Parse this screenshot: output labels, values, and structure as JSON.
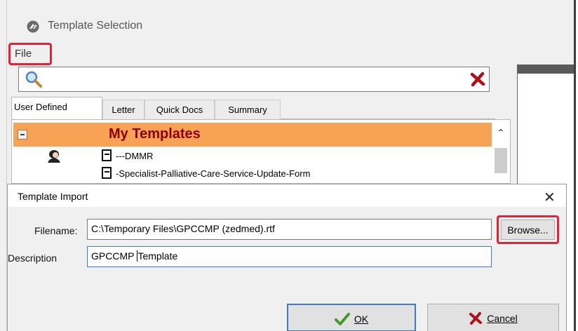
{
  "window": {
    "title": "Template Selection",
    "icon": "app-logo-icon"
  },
  "menu": {
    "file_label": "File"
  },
  "search": {
    "placeholder": "",
    "search_icon": "magnifier-icon",
    "clear_icon": "red-x-icon"
  },
  "tabs": [
    {
      "label": "User Defined",
      "active": true
    },
    {
      "label": "Letter",
      "active": false
    },
    {
      "label": "Quick Docs",
      "active": false
    },
    {
      "label": "Summary",
      "active": false
    }
  ],
  "template_list": {
    "group_title": "My Templates",
    "group_color": "#f8a255",
    "items": [
      {
        "label": "---DMMR"
      },
      {
        "label": "-Specialist-Palliative-Care-Service-Update-Form"
      }
    ]
  },
  "import_dialog": {
    "title": "Template Import",
    "close_label": "✕",
    "filename_label": "Filename:",
    "filename_value": "C:\\Temporary Files\\GPCCMP (zedmed).rtf",
    "description_label": "Description",
    "description_value_before_caret": "GPCCMP",
    "description_value_after_caret": "Template",
    "browse_label": "Browse...",
    "ok_label": "OK",
    "cancel_label": "Cancel"
  },
  "colors": {
    "highlight_red": "#e1243a",
    "group_title": "#8b0000",
    "focus_blue": "#3b7ad9"
  }
}
